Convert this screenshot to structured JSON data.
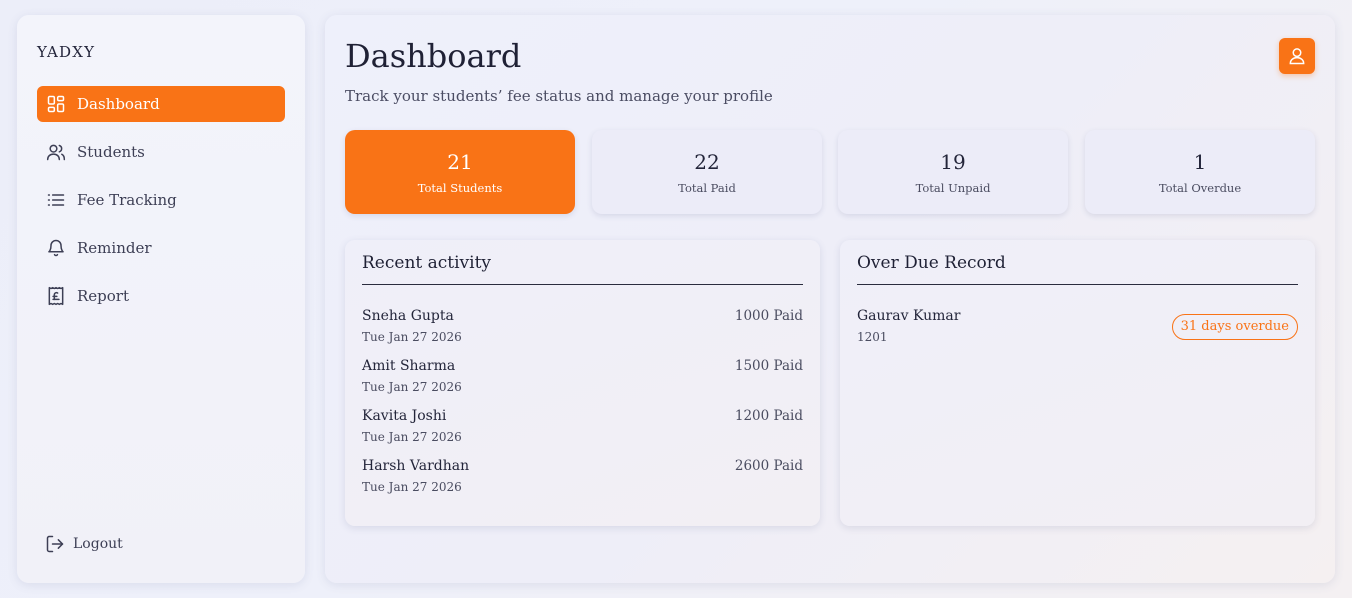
{
  "sidebar": {
    "brand": "YADXY",
    "items": [
      {
        "label": "Dashboard",
        "icon": "grid-icon",
        "active": true
      },
      {
        "label": "Students",
        "icon": "users-icon",
        "active": false
      },
      {
        "label": "Fee Tracking",
        "icon": "list-icon",
        "active": false
      },
      {
        "label": "Reminder",
        "icon": "bell-icon",
        "active": false
      },
      {
        "label": "Report",
        "icon": "receipt-pound-icon",
        "active": false
      }
    ],
    "logout_label": "Logout"
  },
  "header": {
    "title": "Dashboard",
    "subtitle": "Track your students’ fee status and manage your profile",
    "profile_icon": "user-icon"
  },
  "stats": [
    {
      "value": "21",
      "label": "Total Students",
      "active": true
    },
    {
      "value": "22",
      "label": "Total Paid",
      "active": false
    },
    {
      "value": "19",
      "label": "Total Unpaid",
      "active": false
    },
    {
      "value": "1",
      "label": "Total Overdue",
      "active": false
    }
  ],
  "recent_activity": {
    "title": "Recent activity",
    "rows": [
      {
        "name": "Sneha Gupta",
        "date": "Tue Jan 27 2026",
        "amount": "1000 Paid"
      },
      {
        "name": "Amit Sharma",
        "date": "Tue Jan 27 2026",
        "amount": "1500 Paid"
      },
      {
        "name": "Kavita Joshi",
        "date": "Tue Jan 27 2026",
        "amount": "1200 Paid"
      },
      {
        "name": "Harsh Vardhan",
        "date": "Tue Jan 27 2026",
        "amount": "2600 Paid"
      }
    ]
  },
  "overdue": {
    "title": "Over Due Record",
    "rows": [
      {
        "name": "Gaurav Kumar",
        "amount": "1201",
        "badge": "31 days overdue"
      }
    ]
  },
  "colors": {
    "accent": "#f97316",
    "text": "#23253a",
    "card": "#ececf8"
  }
}
